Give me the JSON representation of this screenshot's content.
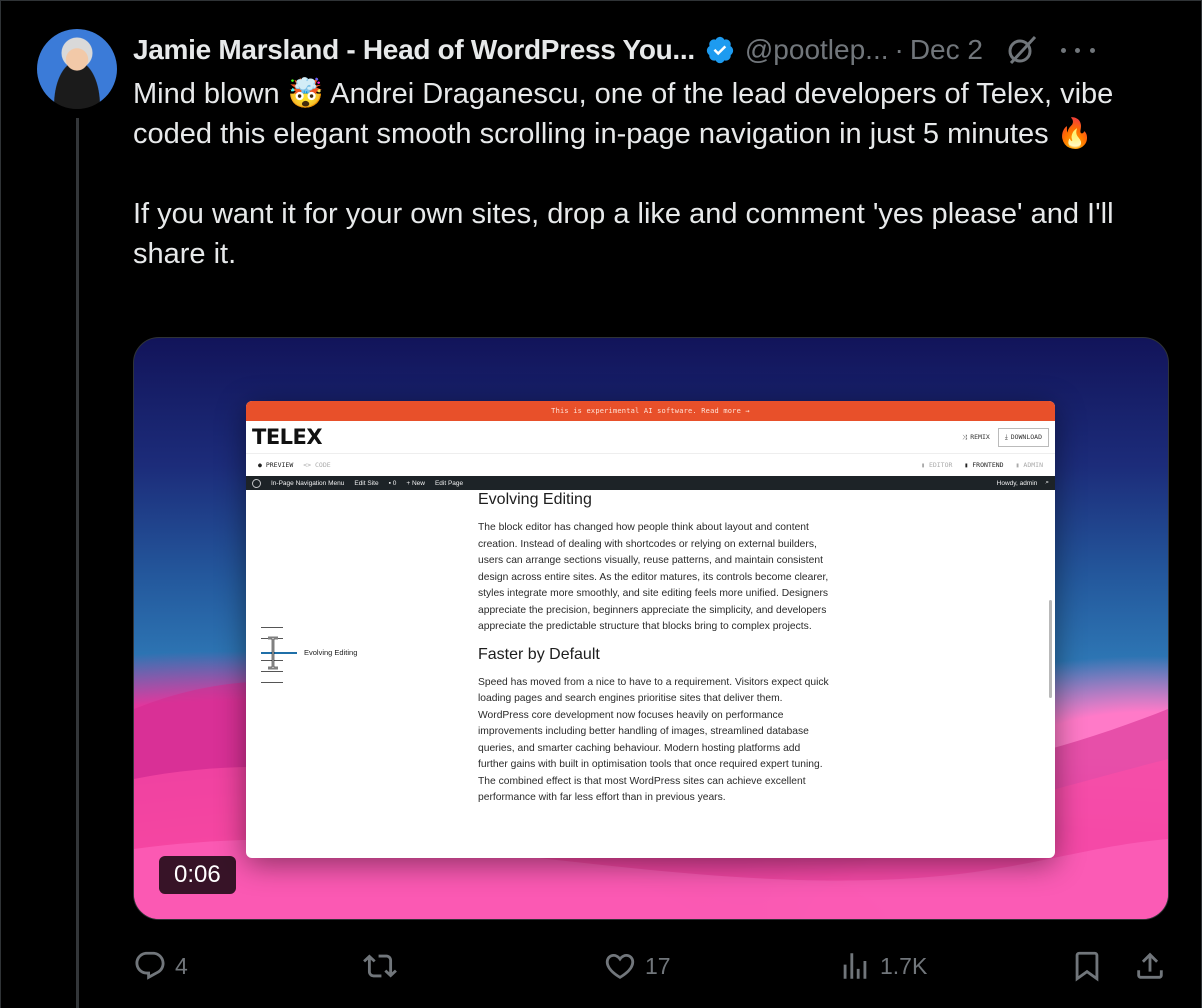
{
  "tweet": {
    "author_name": "Jamie Marsland - Head of WordPress You...",
    "handle": "@pootlep...",
    "separator": "·",
    "date": "Dec 2",
    "text": "Mind blown 🤯 Andrei Draganescu, one of the lead developers of Telex, vibe coded this elegant smooth scrolling in-page navigation in just 5 minutes 🔥\n\nIf you want it for your own sites, drop a like and comment 'yes please' and I'll share it."
  },
  "video": {
    "timestamp": "0:06",
    "browser": {
      "banner": "This is experimental AI software. Read more →",
      "logo": "TELEX",
      "remix_label": "REMIX",
      "download_label": "DOWNLOAD",
      "tab_preview": "PREVIEW",
      "tab_code": "<> CODE",
      "tab_editor": "EDITOR",
      "tab_frontend": "FRONTEND",
      "tab_admin": "ADMIN",
      "admin_site": "In-Page Navigation Menu",
      "admin_edit_site": "Edit Site",
      "admin_comments": "0",
      "admin_new": "New",
      "admin_edit_page": "Edit Page",
      "admin_howdy": "Howdy, admin",
      "nav_active_label": "Evolving Editing",
      "section1_title": "Evolving Editing",
      "section1_body": "The block editor has changed how people think about layout and content creation. Instead of dealing with shortcodes or relying on external builders, users can arrange sections visually, reuse patterns, and maintain consistent design across entire sites. As the editor matures, its controls become clearer, styles integrate more smoothly, and site editing feels more unified. Designers appreciate the precision, beginners appreciate the simplicity, and developers appreciate the predictable structure that blocks bring to complex projects.",
      "section2_title": "Faster by Default",
      "section2_body": "Speed has moved from a nice to have to a requirement. Visitors expect quick loading pages and search engines prioritise sites that deliver them. WordPress core development now focuses heavily on performance improvements including better handling of images, streamlined database queries, and smarter caching behaviour. Modern hosting platforms add further gains with built in optimisation tools that once required expert tuning. The combined effect is that most WordPress sites can achieve excellent performance with far less effort than in previous years."
    }
  },
  "actions": {
    "replies": "4",
    "retweets": "",
    "likes": "17",
    "views": "1.7K"
  },
  "colors": {
    "background": "#000000",
    "text": "#e7e9ea",
    "muted": "#71767b",
    "verified": "#1d9bf0",
    "telex_banner": "#e8502a"
  }
}
